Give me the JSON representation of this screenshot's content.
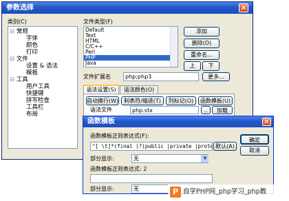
{
  "main_dialog": {
    "title": "参数选择",
    "category_label": "类别(C)",
    "categories": [
      {
        "label": "常规",
        "children": [
          "字体",
          "颜色",
          "打印"
        ]
      },
      {
        "label": "文件",
        "children": [
          "设置 & 语法",
          "模板"
        ]
      },
      {
        "label": "工具",
        "children": [
          "用户工具",
          "快捷键",
          "拼写检查",
          "工具栏",
          "布局"
        ]
      }
    ],
    "file_type_label": "文件类型(F)",
    "file_types": [
      "Default",
      "Text",
      "HTML",
      "C/C++",
      "Perl",
      "PHP",
      "Java"
    ],
    "selected_file_type": "PHP",
    "buttons": {
      "add": "添加",
      "delete": "删除(D)",
      "rename": "重命名...",
      "up": "上",
      "down": "下"
    },
    "extension_label": "文件扩展名",
    "extension_value": "php;php3",
    "more_button": "更多...",
    "tabs": [
      "语法设置(S)",
      "语法颜色(O)"
    ],
    "options": [
      "自动换行(W)",
      "制表符/缩进(T)",
      "列标记(O)",
      "函数模板(U)"
    ],
    "syntax_file_label": "语法文件",
    "syntax_file_value": "php.stx",
    "browse_button": "..",
    "load_button": "加载"
  },
  "func_dialog": {
    "title": "函数模板",
    "regex_label": "函数模板正则表达式(F):",
    "regex_value": "^[ \\t]*(final )?(public |private |protec",
    "default_button": "默认(A)",
    "ok_button": "确定",
    "cancel_button": "取消",
    "display_label": "部分显示:",
    "display_value": "无",
    "regex2_label": "函数模板正则表达式: 2",
    "regex2_value": "",
    "display2_label": "部分显示:",
    "display2_value": "无"
  },
  "watermark": {
    "logo_letter": "P",
    "text": "自学PHP网_php学习_php教"
  },
  "colors": {
    "title_bar": "#2357c8",
    "selection": "#316ac5",
    "window_bg": "#ece9d8",
    "watermark_orange": "#f47a20"
  }
}
